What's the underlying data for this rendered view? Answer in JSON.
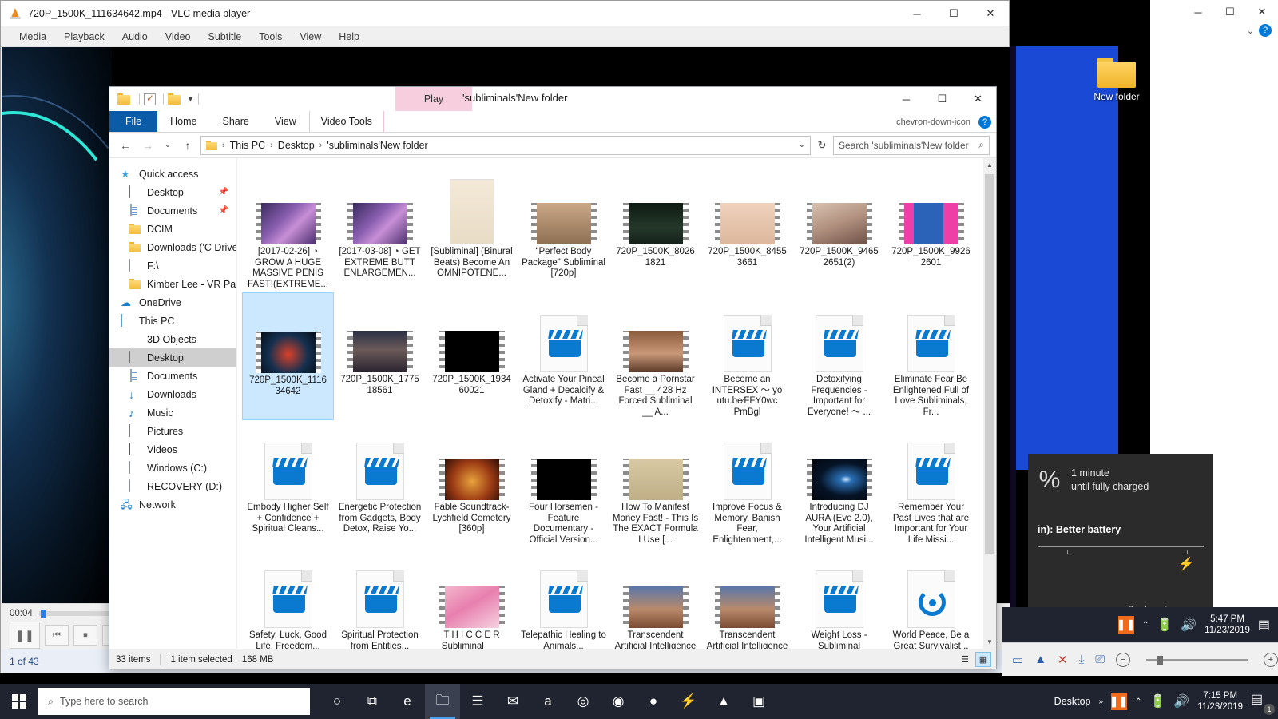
{
  "vlc": {
    "title": "720P_1500K_111634642.mp4 - VLC media player",
    "app_icon": "vlc-cone-icon",
    "menu": [
      "Media",
      "Playback",
      "Audio",
      "Video",
      "Subtitle",
      "Tools",
      "View",
      "Help"
    ],
    "time_elapsed": "00:04",
    "status": "1 of 43",
    "controls": {
      "play_pause": "pause-icon",
      "previous": "previous-icon",
      "stop": "stop-icon",
      "next": "next-icon"
    },
    "window_buttons": {
      "minimize": "─",
      "maximize": "☐",
      "close": "✕"
    }
  },
  "explorer": {
    "title": "'subliminals'New folder",
    "quick_access_toolbar": [
      "folder-icon",
      "properties-checkbox-icon",
      "new-folder-icon",
      "customize-chevron-icon"
    ],
    "contextual_tab_group": "Play",
    "ribbon_tabs": [
      "File",
      "Home",
      "Share",
      "View",
      "Video Tools"
    ],
    "ribbon_active_tab": "File",
    "ribbon_right": {
      "collapse": "chevron-down-icon",
      "help": "?"
    },
    "window_buttons": {
      "minimize": "─",
      "maximize": "☐",
      "close": "✕"
    },
    "address": {
      "back": "←",
      "forward": "→",
      "recent": "⌄",
      "up": "↑",
      "breadcrumbs": [
        "This PC",
        "Desktop",
        "'subliminals'New folder"
      ],
      "dropdown": "⌄",
      "refresh": "↻"
    },
    "search": {
      "placeholder": "Search 'subliminals'New folder",
      "value": "",
      "icon": "search-icon"
    },
    "nav_pane": [
      {
        "label": "Quick access",
        "icon": "star-icon",
        "indent": 0,
        "pinned": false,
        "selected": false
      },
      {
        "label": "Desktop",
        "icon": "desktop-icon",
        "indent": 1,
        "pinned": true,
        "selected": false
      },
      {
        "label": "Documents",
        "icon": "documents-icon",
        "indent": 1,
        "pinned": true,
        "selected": false
      },
      {
        "label": "DCIM",
        "icon": "folder-icon",
        "indent": 1,
        "pinned": false,
        "selected": false
      },
      {
        "label": "Downloads ('C Drive",
        "icon": "folder-icon",
        "indent": 1,
        "pinned": false,
        "selected": false
      },
      {
        "label": "F:\\",
        "icon": "drive-icon",
        "indent": 1,
        "pinned": false,
        "selected": false
      },
      {
        "label": "Kimber Lee - VR Pac",
        "icon": "folder-icon",
        "indent": 1,
        "pinned": false,
        "selected": false
      },
      {
        "label": "OneDrive",
        "icon": "cloud-icon",
        "indent": 0,
        "pinned": false,
        "selected": false
      },
      {
        "label": "This PC",
        "icon": "pc-icon",
        "indent": 0,
        "pinned": false,
        "selected": false
      },
      {
        "label": "3D Objects",
        "icon": "3d-objects-icon",
        "indent": 1,
        "pinned": false,
        "selected": false
      },
      {
        "label": "Desktop",
        "icon": "desktop-icon",
        "indent": 1,
        "pinned": false,
        "selected": true
      },
      {
        "label": "Documents",
        "icon": "documents-icon",
        "indent": 1,
        "pinned": false,
        "selected": false
      },
      {
        "label": "Downloads",
        "icon": "downloads-icon",
        "indent": 1,
        "pinned": false,
        "selected": false
      },
      {
        "label": "Music",
        "icon": "music-icon",
        "indent": 1,
        "pinned": false,
        "selected": false
      },
      {
        "label": "Pictures",
        "icon": "pictures-icon",
        "indent": 1,
        "pinned": false,
        "selected": false
      },
      {
        "label": "Videos",
        "icon": "videos-icon",
        "indent": 1,
        "pinned": false,
        "selected": false
      },
      {
        "label": "Windows (C:)",
        "icon": "drive-icon",
        "indent": 1,
        "pinned": false,
        "selected": false
      },
      {
        "label": "RECOVERY (D:)",
        "icon": "drive-icon",
        "indent": 1,
        "pinned": false,
        "selected": false
      },
      {
        "label": "Network",
        "icon": "network-icon",
        "indent": 0,
        "pinned": false,
        "selected": false
      }
    ],
    "files": [
      {
        "label": "[2017-02-26] ◔ GROW A HUGE MASSIVE PENIS FAST!(EXTREME...",
        "thumb": "film",
        "art": "fairy",
        "selected": false
      },
      {
        "label": "[2017-03-08] ◔ GET EXTREME BUTT ENLARGEMEN...",
        "thumb": "film",
        "art": "fairy",
        "selected": false
      },
      {
        "label": "[Subliminal] (Binural Beats) Become An OMNIPOTENE...",
        "thumb": "plain",
        "art": "anime",
        "selected": false
      },
      {
        "label": "“Perfect Body Package” Subliminal [720p]",
        "thumb": "film",
        "art": "tan",
        "selected": false
      },
      {
        "label": "720P_1500K_8026 1821",
        "thumb": "film",
        "art": "dark-room",
        "selected": false
      },
      {
        "label": "720P_1500K_8455 3661",
        "thumb": "film",
        "art": "skin",
        "selected": false
      },
      {
        "label": "720P_1500K_9465 2651(2)",
        "thumb": "film",
        "art": "face",
        "selected": false
      },
      {
        "label": "720P_1500K_9926 2601",
        "thumb": "film",
        "art": "pink",
        "selected": false
      },
      {
        "label": "720P_1500K_1116 34642",
        "thumb": "film",
        "art": "neon",
        "selected": true
      },
      {
        "label": "720P_1500K_1775 18561",
        "thumb": "film",
        "art": "eyes",
        "selected": false
      },
      {
        "label": "720P_1500K_1934 60021",
        "thumb": "film",
        "art": "pornhub",
        "selected": false
      },
      {
        "label": "Activate Your Pineal Gland + Decalcify & Detoxify - Matri...",
        "thumb": "clapper",
        "art": "",
        "selected": false
      },
      {
        "label": "Become a Pornstar Fast __ 428 Hz Forced Subliminal __ A...",
        "thumb": "film",
        "art": "couple",
        "selected": false
      },
      {
        "label": "Become an INTERSEX ～  yo utu.be∕FFY0wc PmBgl",
        "thumb": "clapper",
        "art": "",
        "selected": false
      },
      {
        "label": "Detoxifying Frequencies - Important for Everyone! ～  ...",
        "thumb": "clapper",
        "art": "",
        "selected": false
      },
      {
        "label": "Eliminate Fear Be Enlightened Full of Love Subliminals, Fr...",
        "thumb": "clapper",
        "art": "",
        "selected": false
      },
      {
        "label": "Embody Higher Self + Confidence + Spiritual Cleans...",
        "thumb": "clapper",
        "art": "",
        "selected": false
      },
      {
        "label": "Energetic Protection from Gadgets, Body Detox, Raise Yo...",
        "thumb": "clapper",
        "art": "",
        "selected": false
      },
      {
        "label": "Fable Soundtrack-Lychfield Cemetery [360p]",
        "thumb": "film",
        "art": "fable",
        "selected": false
      },
      {
        "label": "Four Horsemen - Feature Documentary - Official Version...",
        "thumb": "film",
        "art": "horsemen",
        "selected": false
      },
      {
        "label": "How To Manifest Money Fast! - This Is The EXACT Formula I Use [...",
        "thumb": "film",
        "art": "money",
        "selected": false
      },
      {
        "label": "Improve Focus & Memory, Banish Fear, Enlightenment,...",
        "thumb": "clapper",
        "art": "",
        "selected": false
      },
      {
        "label": "Introducing DJ AURA (Eve 2.0), Your Artificial Intelligent Musi...",
        "thumb": "film",
        "art": "space",
        "selected": false
      },
      {
        "label": "Remember Your Past Lives that are Important for Your Life Missi...",
        "thumb": "clapper",
        "art": "",
        "selected": false
      },
      {
        "label": "Safety, Luck, Good Life, Freedom...",
        "thumb": "clapper",
        "art": "",
        "selected": false
      },
      {
        "label": "Spiritual Protection from Entities...",
        "thumb": "clapper",
        "art": "",
        "selected": false
      },
      {
        "label": "T H I C C E R Subliminal_ __ (ama)...",
        "thumb": "film",
        "art": "floral",
        "selected": false
      },
      {
        "label": "Telepathic Healing to Animals...",
        "thumb": "clapper",
        "art": "",
        "selected": false
      },
      {
        "label": "Transcendent Artificial Intelligence Tech...",
        "thumb": "film",
        "art": "statue",
        "selected": false
      },
      {
        "label": "Transcendent Artificial Intelligence Tech...",
        "thumb": "film",
        "art": "statue",
        "selected": false
      },
      {
        "label": "Weight Loss - Subliminal Technique ... /",
        "thumb": "clapper",
        "art": "",
        "selected": false
      },
      {
        "label": "World Peace, Be a Great Survivalist...",
        "thumb": "disc",
        "art": "",
        "selected": false
      }
    ],
    "status": {
      "item_count": "33 items",
      "selection": "1 item selected",
      "size": "168 MB",
      "view_details_icon": "details-view-icon",
      "view_large_icons_icon": "large-icons-view-icon"
    },
    "scrollbar": {
      "up": "▲",
      "down": "▼"
    }
  },
  "desktop": {
    "icon_label": "New folder",
    "icon_name": "folder-icon"
  },
  "battery_flyout": {
    "percent_glyph": "%",
    "line1": "1 minute",
    "line2": "until fully charged",
    "mode_label": "in): Better battery",
    "best_performance": "Best performance",
    "bolt_icon": "lightning-bolt-icon"
  },
  "taskbar": {
    "start_icon": "windows-start-icon",
    "search_placeholder": "Type here to search",
    "search_icon": "search-icon",
    "items": [
      {
        "name": "cortana-icon",
        "glyph": "○"
      },
      {
        "name": "task-view-icon",
        "glyph": "⧉"
      },
      {
        "name": "edge-icon",
        "glyph": "e"
      },
      {
        "name": "file-explorer-icon",
        "glyph": "🗀"
      },
      {
        "name": "microsoft-store-icon",
        "glyph": "☰"
      },
      {
        "name": "mail-icon",
        "glyph": "✉"
      },
      {
        "name": "amazon-icon",
        "glyph": "a"
      },
      {
        "name": "tripadvisor-icon",
        "glyph": "◎"
      },
      {
        "name": "camera-icon",
        "glyph": "◉"
      },
      {
        "name": "colorful-app-icon",
        "glyph": "●"
      },
      {
        "name": "lightning-app-icon",
        "glyph": "⚡"
      },
      {
        "name": "vlc-icon",
        "glyph": "▲"
      },
      {
        "name": "media-app-icon",
        "glyph": "▣"
      }
    ]
  },
  "tray_top": {
    "vlc_icon": "vlc-tray-icon",
    "chevron": "⌃",
    "battery_icon": "battery-charging-icon",
    "volume_icon": "speaker-icon",
    "time": "5:47 PM",
    "date": "11/23/2019",
    "action_center_icon": "action-center-icon"
  },
  "taskbar2": {
    "label": "Desktop",
    "overflow": "»",
    "vlc_icon": "vlc-tray-icon",
    "chevron": "⌃",
    "battery_icon": "battery-charging-icon",
    "volume_icon": "speaker-icon",
    "time": "7:15 PM",
    "date": "11/23/2019",
    "action_center_icon": "action-center-icon",
    "notification_count": "1"
  },
  "right_window": {
    "minimize": "─",
    "maximize": "☐",
    "close": "✕",
    "chevron": "⌄",
    "help": "?"
  },
  "ribbon_strip_right": {
    "icons": [
      "monitor-icon",
      "cast-icon",
      "close-icon",
      "present-icon",
      "zoom-out-icon",
      "zoom-in-icon",
      "info-icon"
    ]
  }
}
